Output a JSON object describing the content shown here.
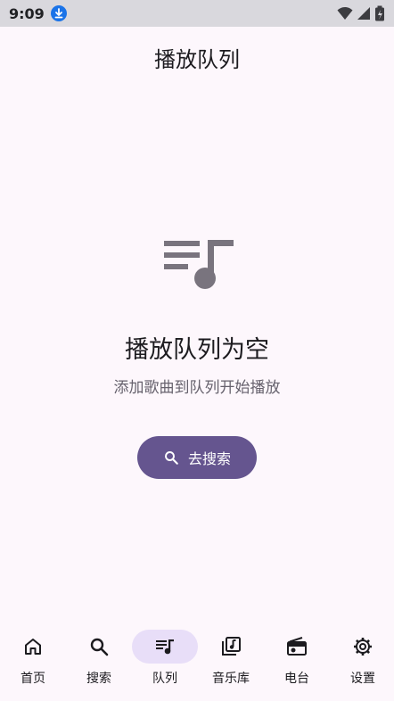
{
  "status_bar": {
    "time": "9:09",
    "icons": [
      "download-icon",
      "wifi-icon",
      "signal-icon",
      "battery-icon"
    ]
  },
  "header": {
    "title": "播放队列"
  },
  "empty_state": {
    "icon": "queue-music-icon",
    "title": "播放队列为空",
    "subtitle": "添加歌曲到队列开始播放",
    "button_label": "去搜索",
    "button_icon": "search-icon"
  },
  "nav": {
    "items": [
      {
        "label": "首页",
        "icon": "home-icon",
        "active": false
      },
      {
        "label": "搜索",
        "icon": "search-icon",
        "active": false
      },
      {
        "label": "队列",
        "icon": "queue-icon",
        "active": true
      },
      {
        "label": "音乐库",
        "icon": "library-icon",
        "active": false
      },
      {
        "label": "电台",
        "icon": "radio-icon",
        "active": false
      },
      {
        "label": "设置",
        "icon": "settings-icon",
        "active": false
      }
    ]
  },
  "colors": {
    "background": "#fdf7fc",
    "accent": "#65558f",
    "active_pill": "#e8def8",
    "icon": "#79747e"
  }
}
